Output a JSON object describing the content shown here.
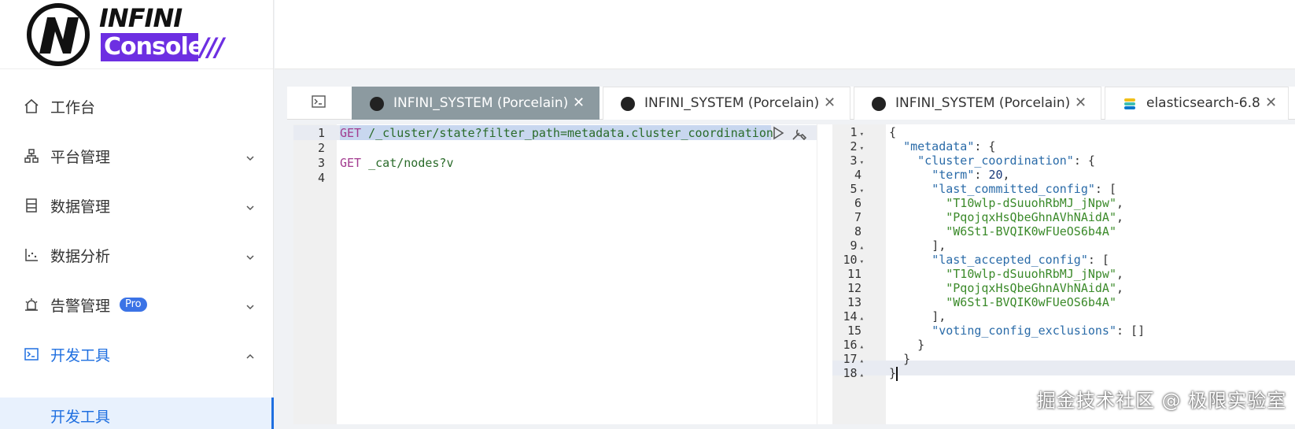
{
  "brand": {
    "word1": "INFINI",
    "word2": "Console",
    "slashes": "///"
  },
  "sidebar": {
    "items": [
      {
        "label": "工作台",
        "icon": "home-icon",
        "expanded": null
      },
      {
        "label": "平台管理",
        "icon": "cluster-icon",
        "expanded": false
      },
      {
        "label": "数据管理",
        "icon": "database-icon",
        "expanded": false
      },
      {
        "label": "数据分析",
        "icon": "chart-icon",
        "expanded": false
      },
      {
        "label": "告警管理",
        "icon": "alarm-icon",
        "expanded": false,
        "badge": "Pro"
      },
      {
        "label": "开发工具",
        "icon": "terminal-icon",
        "expanded": true
      }
    ],
    "sub_active": "开发工具"
  },
  "tabs": [
    {
      "label": "INFINI_SYSTEM (Porcelain)",
      "active": true
    },
    {
      "label": "INFINI_SYSTEM (Porcelain)",
      "active": false
    },
    {
      "label": "INFINI_SYSTEM (Porcelain)",
      "active": false
    },
    {
      "label": "elasticsearch-6.8",
      "active": false
    }
  ],
  "request_editor": {
    "line_numbers": [
      "1",
      "2",
      "3",
      "4"
    ],
    "line1_method": "GET",
    "line1_path": " /_cluster/state?filter_path=metadata.cluster_coordination",
    "line3_method": "GET",
    "line3_path": " _cat/nodes?v"
  },
  "response_editor": {
    "line_numbers": [
      "1",
      "2",
      "3",
      "4",
      "5",
      "6",
      "7",
      "8",
      "9",
      "10",
      "11",
      "12",
      "13",
      "14",
      "15",
      "16",
      "17",
      "18"
    ],
    "l1": "{",
    "l2_key": "\"metadata\"",
    "l2_rest": ": {",
    "l3_key": "\"cluster_coordination\"",
    "l3_rest": ": {",
    "l4_key": "\"term\"",
    "l4_sep": ": ",
    "l4_val": "20",
    "l4_end": ",",
    "l5_key": "\"last_committed_config\"",
    "l5_rest": ": [",
    "l6": "\"T10wlp-dSuuohRbMJ_jNpw\"",
    "l6_end": ",",
    "l7": "\"PqojqxHsQbeGhnAVhNAidA\"",
    "l7_end": ",",
    "l8": "\"W6St1-BVQIK0wFUeOS6b4A\"",
    "l9": "],",
    "l10_key": "\"last_accepted_config\"",
    "l10_rest": ": [",
    "l11": "\"T10wlp-dSuuohRbMJ_jNpw\"",
    "l11_end": ",",
    "l12": "\"PqojqxHsQbeGhnAVhNAidA\"",
    "l12_end": ",",
    "l13": "\"W6St1-BVQIK0wFUeOS6b4A\"",
    "l14": "],",
    "l15_key": "\"voting_config_exclusions\"",
    "l15_rest": ": []",
    "l16": "}",
    "l17": "}",
    "l18": "}"
  },
  "watermark": "掘金技术社区 @ 极限实验室",
  "colors": {
    "accent": "#1f6fe0",
    "brand_purple": "#6d2fe2",
    "active_tab": "#8c9aa0"
  }
}
